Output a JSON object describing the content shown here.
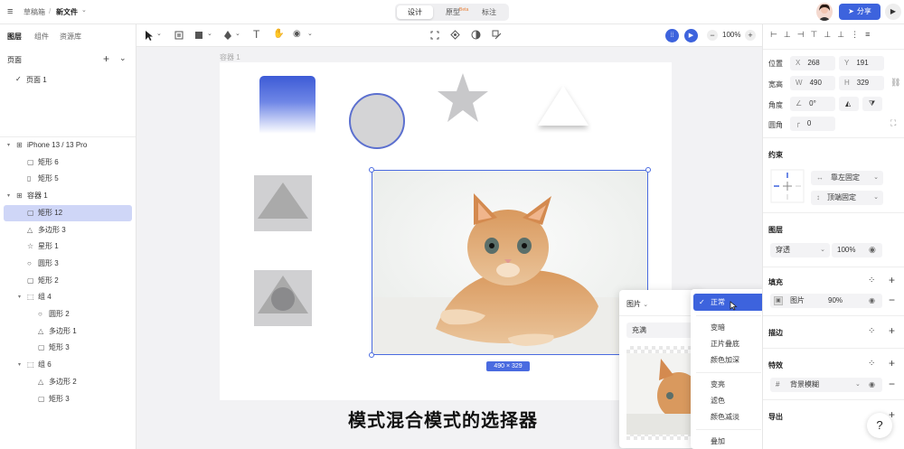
{
  "topbar": {
    "breadcrumb_parent": "草稿箱",
    "breadcrumb_sep": "/",
    "file_name": "新文件",
    "tabs": [
      {
        "label": "设计",
        "active": true
      },
      {
        "label": "原型",
        "badge": "Beta"
      },
      {
        "label": "标注"
      }
    ],
    "share_label": "分享"
  },
  "left_panel": {
    "tabs": [
      "图层",
      "组件",
      "资源库"
    ],
    "pages_title": "页面",
    "pages": [
      {
        "label": "页面 1",
        "checked": "✓"
      }
    ],
    "layers": [
      {
        "label": "iPhone 13 / 13 Pro",
        "icon": "frame-icon",
        "indent": 0,
        "arrow": "▾"
      },
      {
        "label": "矩形 6",
        "icon": "rect-icon",
        "indent": 1
      },
      {
        "label": "矩形 5",
        "icon": "rect-tall-icon",
        "indent": 1
      },
      {
        "label": "容器 1",
        "icon": "frame-icon",
        "indent": 0,
        "arrow": "▾"
      },
      {
        "label": "矩形 12",
        "icon": "rect-icon",
        "indent": 1,
        "selected": true
      },
      {
        "label": "多边形 3",
        "icon": "triangle-icon",
        "indent": 1
      },
      {
        "label": "星形 1",
        "icon": "star-icon",
        "indent": 1
      },
      {
        "label": "圆形 3",
        "icon": "circle-icon",
        "indent": 1
      },
      {
        "label": "矩形 2",
        "icon": "rect-icon",
        "indent": 1
      },
      {
        "label": "组 4",
        "icon": "group-icon",
        "indent": 1,
        "arrow": "▾"
      },
      {
        "label": "圆形 2",
        "icon": "circle-icon",
        "indent": 2
      },
      {
        "label": "多边形 1",
        "icon": "triangle-icon",
        "indent": 2
      },
      {
        "label": "矩形 3",
        "icon": "rect-icon",
        "indent": 2
      },
      {
        "label": "组 6",
        "icon": "group-icon",
        "indent": 1,
        "arrow": "▾"
      },
      {
        "label": "多边形 2",
        "icon": "triangle-icon",
        "indent": 2
      },
      {
        "label": "矩形 3",
        "icon": "rect-icon",
        "indent": 2
      }
    ]
  },
  "toolbar": {
    "zoom": "100%",
    "minus": "−",
    "plus": "+"
  },
  "canvas": {
    "frame_label": "容器 1",
    "size_badge": "490 × 329",
    "caption": "模式混合模式的选择器"
  },
  "fill_popup": {
    "type_label": "图片",
    "fit_label": "充满"
  },
  "blend_menu": {
    "options": [
      {
        "label": "正常",
        "selected": true,
        "check": "✓"
      },
      {
        "label": "变暗"
      },
      {
        "label": "正片叠底"
      },
      {
        "label": "颜色加深"
      },
      {
        "label": "变亮"
      },
      {
        "label": "滤色"
      },
      {
        "label": "颜色减淡"
      },
      {
        "label": "叠加"
      }
    ]
  },
  "right_panel": {
    "position_label": "位置",
    "x": {
      "key": "X",
      "value": "268"
    },
    "y": {
      "key": "Y",
      "value": "191"
    },
    "size_label": "宽高",
    "w": {
      "key": "W",
      "value": "490"
    },
    "h": {
      "key": "H",
      "value": "329"
    },
    "angle_label": "角度",
    "angle_value": "0°",
    "radius_label": "圆角",
    "radius_value": "0",
    "constraint_title": "约束",
    "constraint_h": "靠左固定",
    "constraint_v": "顶端固定",
    "layer_title": "图层",
    "layer_blend": "穿透",
    "layer_opacity": "100%",
    "fill_title": "填充",
    "fill_type": "图片",
    "fill_opacity": "90%",
    "stroke_title": "描边",
    "effect_title": "特效",
    "effect_value": "背景模糊",
    "export_title": "导出",
    "help": "?"
  },
  "colors": {
    "accent": "#3d63dd",
    "selection": "#cfd6f7"
  }
}
